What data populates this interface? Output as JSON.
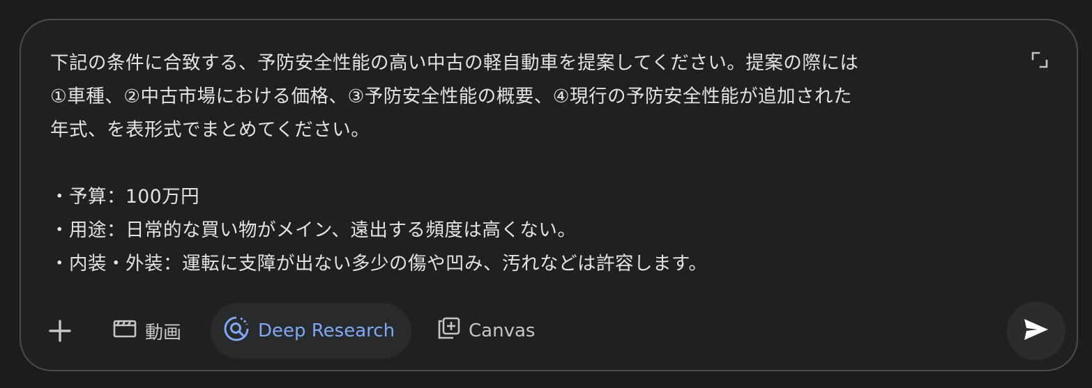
{
  "prompt": {
    "lines": [
      "下記の条件に合致する、予防安全性能の高い中古の軽自動車を提案してください。提案の際には",
      "①車種、②中古市場における価格、③予防安全性能の概要、④現行の予防安全性能が追加された",
      "年式、を表形式でまとめてください。",
      "",
      "・予算：100万円",
      "・用途：日常的な買い物がメイン、遠出する頻度は高くない。",
      "・内装・外装：運転に支障が出ない多少の傷や凹み、汚れなどは許容します。"
    ]
  },
  "toolbar": {
    "add_icon": "plus-icon",
    "video_label": "動画",
    "video_icon": "clapperboard-icon",
    "deep_research_label": "Deep Research",
    "deep_research_icon": "deep-research-icon",
    "canvas_label": "Canvas",
    "canvas_icon": "canvas-icon",
    "send_icon": "send-icon"
  },
  "colors": {
    "background": "#1b1c1d",
    "composer_bg": "#1f2021",
    "border": "#4a4c50",
    "text": "#e3e3e3",
    "muted": "#c4c7c5",
    "accent": "#7fa9f5",
    "chip_active_bg": "#282a2c",
    "send_bg": "#2b2c2e"
  }
}
